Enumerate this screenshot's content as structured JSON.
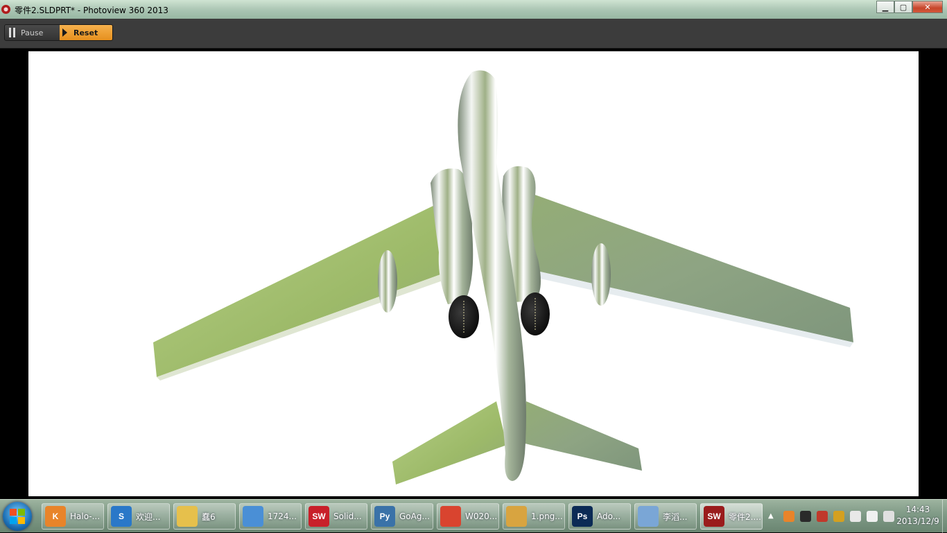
{
  "window": {
    "title": "零件2.SLDPRT* - Photoview 360 2013",
    "controls": {
      "minimize": "▁",
      "maximize": "▢",
      "close": "✕"
    }
  },
  "toolbar": {
    "pause_label": "Pause",
    "reset_label": "Reset"
  },
  "colors": {
    "toolbar_bg": "#3c3c3c",
    "reset_accent": "#f0a235",
    "wing_green": "#a8c472",
    "fuselage_chrome": "#d9dde0",
    "engine_black": "#151515"
  },
  "taskbar": {
    "tasks": [
      {
        "label": "Halo-...",
        "icon": "kingsoft-icon",
        "color": "#e8842a",
        "glyph": "K"
      },
      {
        "label": "欢迎...",
        "icon": "sogou-icon",
        "color": "#2a78c8",
        "glyph": "S"
      },
      {
        "label": "蠢6",
        "icon": "folder-icon",
        "color": "#e6c04c",
        "glyph": ""
      },
      {
        "label": "1724...",
        "icon": "image-viewer-icon",
        "color": "#4a8fd6",
        "glyph": ""
      },
      {
        "label": "Solid...",
        "icon": "solidworks-icon",
        "color": "#c8202a",
        "glyph": "SW"
      },
      {
        "label": "GoAg...",
        "icon": "python-icon",
        "color": "#3a72a8",
        "glyph": "Py"
      },
      {
        "label": "W020...",
        "icon": "chrome-icon",
        "color": "#d9442f",
        "glyph": ""
      },
      {
        "label": "1.png...",
        "icon": "paint-icon",
        "color": "#d8a440",
        "glyph": ""
      },
      {
        "label": "Ado...",
        "icon": "photoshop-icon",
        "color": "#0b2a55",
        "glyph": "Ps"
      },
      {
        "label": "李滔...",
        "icon": "contacts-icon",
        "color": "#7aa6d6",
        "glyph": ""
      },
      {
        "label": "零件2....",
        "icon": "photoview-icon",
        "color": "#9a1c1c",
        "glyph": "SW"
      }
    ],
    "tray_icons": [
      "kingsoft-tray-icon",
      "qq-icon",
      "qq-icon-2",
      "qq-group-icon",
      "network-icon",
      "flag-icon",
      "volume-icon"
    ],
    "clock_time": "14:43",
    "clock_date": "2013/12/9"
  }
}
